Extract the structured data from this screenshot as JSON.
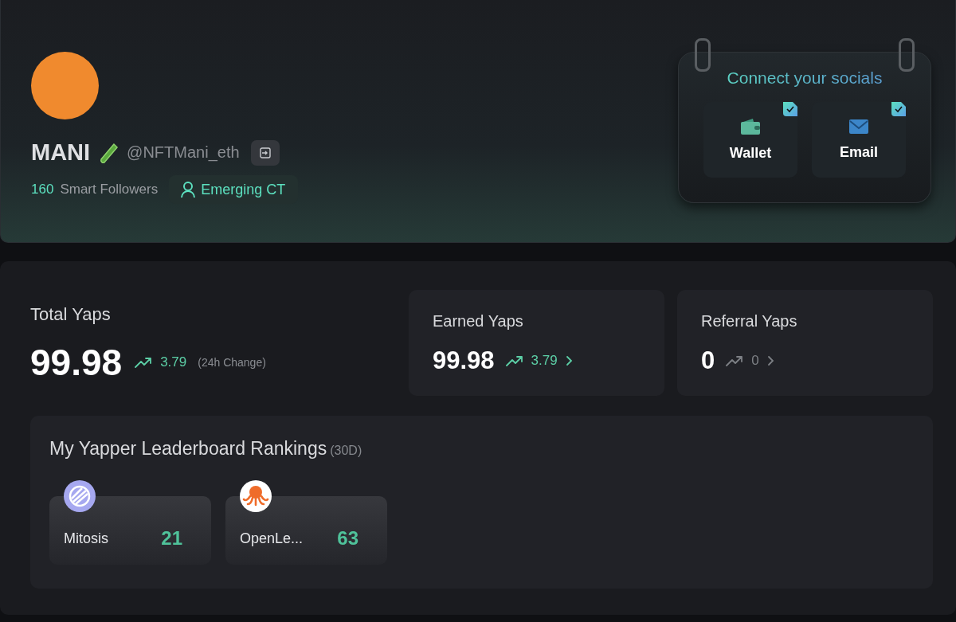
{
  "profile": {
    "name": "MANI",
    "handle": "@NFTMani_eth",
    "followers_count": "160",
    "followers_label": "Smart Followers",
    "badge": "Emerging CT"
  },
  "socials": {
    "title": "Connect your socials",
    "items": [
      {
        "kind": "wallet",
        "label": "Wallet",
        "connected": true
      },
      {
        "kind": "email",
        "label": "Email",
        "connected": true
      }
    ]
  },
  "total": {
    "label": "Total Yaps",
    "value": "99.98",
    "change": "3.79",
    "change_note": "(24h Change)"
  },
  "cards": [
    {
      "label": "Earned Yaps",
      "value": "99.98",
      "change": "3.79",
      "kind": "up"
    },
    {
      "label": "Referral Yaps",
      "value": "0",
      "change": "0",
      "kind": "flat"
    }
  ],
  "leaderboard": {
    "title": "My Yapper Leaderboard Rankings",
    "period": "(30D)",
    "items": [
      {
        "kind": "globe",
        "name": "Mitosis",
        "rank": "21"
      },
      {
        "kind": "octopus",
        "name": "OpenLe...",
        "rank": "63"
      }
    ]
  }
}
